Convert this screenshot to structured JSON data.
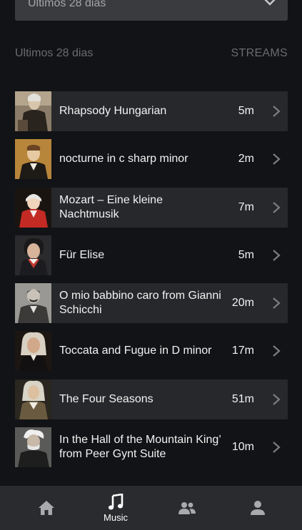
{
  "filter": {
    "selected": "Ultimos 28 dias"
  },
  "section": {
    "period_label": "Ultimos 28 dias",
    "metric_label": "STREAMS"
  },
  "tracks": [
    {
      "title": "Rhapsody Hungarian",
      "streams": "5m"
    },
    {
      "title": "nocturne in c sharp minor",
      "streams": "2m"
    },
    {
      "title": "Mozart – Eine kleine Nachtmusik",
      "streams": "7m"
    },
    {
      "title": "Für Elise",
      "streams": "5m"
    },
    {
      "title": "O mio babbino caro from Gianni Schicchi",
      "streams": "20m"
    },
    {
      "title": " Toccata and Fugue in D minor",
      "streams": "17m"
    },
    {
      "title": "The Four Seasons",
      "streams": "51m"
    },
    {
      "title": "In the Hall of the Mountain King’ from Peer Gynt Suite",
      "streams": "10m"
    }
  ],
  "tabbar": {
    "music_label": "Music",
    "active": "music",
    "icons": [
      "home-icon",
      "music-note-icon",
      "people-icon",
      "person-icon"
    ]
  },
  "colors": {
    "background": "#121316",
    "row_shaded": "#27282b",
    "tabbar": "#2a2b2e",
    "muted_text": "#6a6b6f"
  }
}
